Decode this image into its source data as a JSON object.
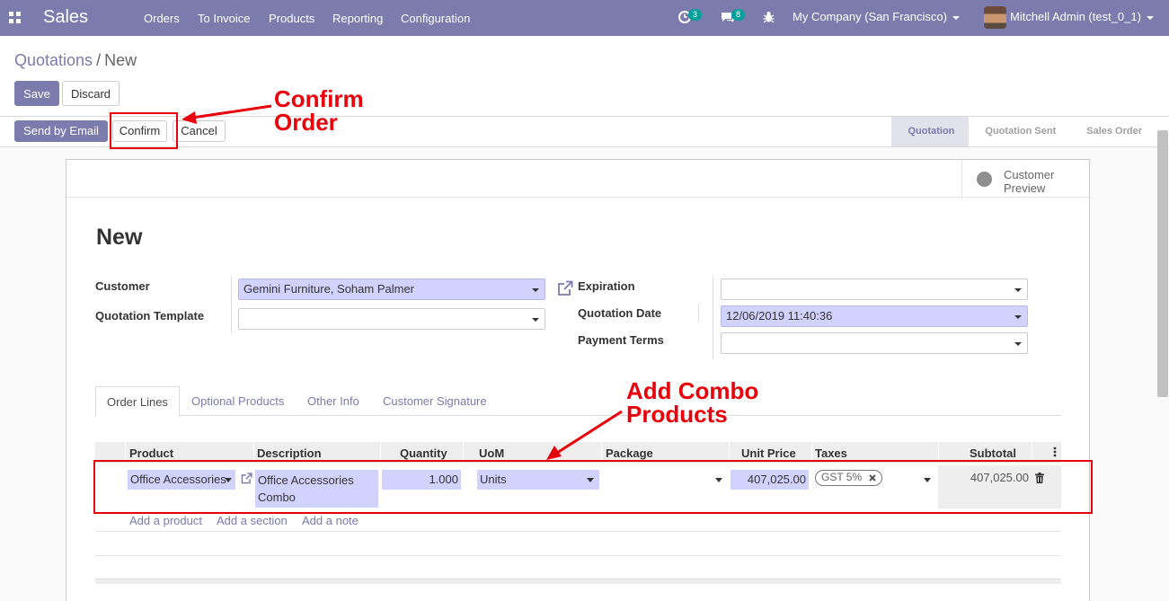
{
  "navbar": {
    "app_name": "Sales",
    "menu": [
      "Orders",
      "To Invoice",
      "Products",
      "Reporting",
      "Configuration"
    ],
    "activity_count": "3",
    "messages_count": "8",
    "company": "My Company (San Francisco)",
    "user": "Mitchell Admin (test_0_1)"
  },
  "breadcrumb": {
    "parent": "Quotations",
    "separator": "/",
    "current": "New"
  },
  "buttons": {
    "save": "Save",
    "discard": "Discard",
    "send_by_email": "Send by Email",
    "confirm": "Confirm",
    "cancel": "Cancel"
  },
  "stages": [
    "Quotation",
    "Quotation Sent",
    "Sales Order"
  ],
  "smart_button": {
    "label": "Customer Preview",
    "icon": "globe-icon"
  },
  "record_title": "New",
  "form": {
    "customer_label": "Customer",
    "customer_value": "Gemini Furniture, Soham Palmer",
    "template_label": "Quotation Template",
    "template_value": "",
    "expiration_label": "Expiration",
    "expiration_value": "",
    "date_label": "Quotation Date",
    "date_value": "12/06/2019 11:40:36",
    "terms_label": "Payment Terms",
    "terms_value": ""
  },
  "tabs": [
    "Order Lines",
    "Optional Products",
    "Other Info",
    "Customer Signature"
  ],
  "table": {
    "headers": [
      "Product",
      "Description",
      "Quantity",
      "UoM",
      "Package",
      "Unit Price",
      "Taxes",
      "Subtotal"
    ],
    "row": {
      "product": "Office Accessories",
      "description": "Office Accessories Combo",
      "quantity": "1.000",
      "uom": "Units",
      "package": "",
      "unit_price": "407,025.00",
      "tax": "GST 5%",
      "subtotal": "407,025.00"
    },
    "add_links": [
      "Add a product",
      "Add a section",
      "Add a note"
    ]
  },
  "annotations": {
    "confirm_order_line1": "Confirm",
    "confirm_order_line2": "Order",
    "add_combo_line1": "Add Combo",
    "add_combo_line2": "Products",
    "color": "#e8000b"
  },
  "colors": {
    "brand": "#7c7bad",
    "required_field": "#d2d2ff"
  }
}
